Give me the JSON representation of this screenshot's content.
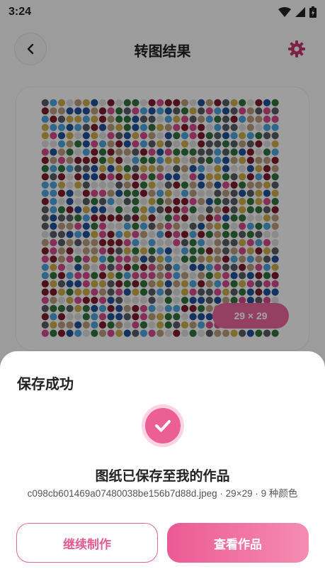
{
  "status_bar": {
    "time": "3:24"
  },
  "header": {
    "title": "转图结果"
  },
  "preview": {
    "size_badge": "29 × 29"
  },
  "sheet": {
    "title": "保存成功",
    "message": "图纸已保存至我的作品",
    "detail": "c098cb601469a07480038be156b7d88d.jpeg · 29×29 · 9 种颜色",
    "continue_label": "继续制作",
    "view_label": "查看作品"
  },
  "colors": {
    "accent": "#e7659b",
    "bead_palette": [
      "#7a1a2a",
      "#2f6f3a",
      "#4aa0d8",
      "#d14a8a",
      "#c9a94a",
      "#555a60",
      "#b89a7a",
      "#1e4f96",
      "#d8d8d8"
    ]
  }
}
